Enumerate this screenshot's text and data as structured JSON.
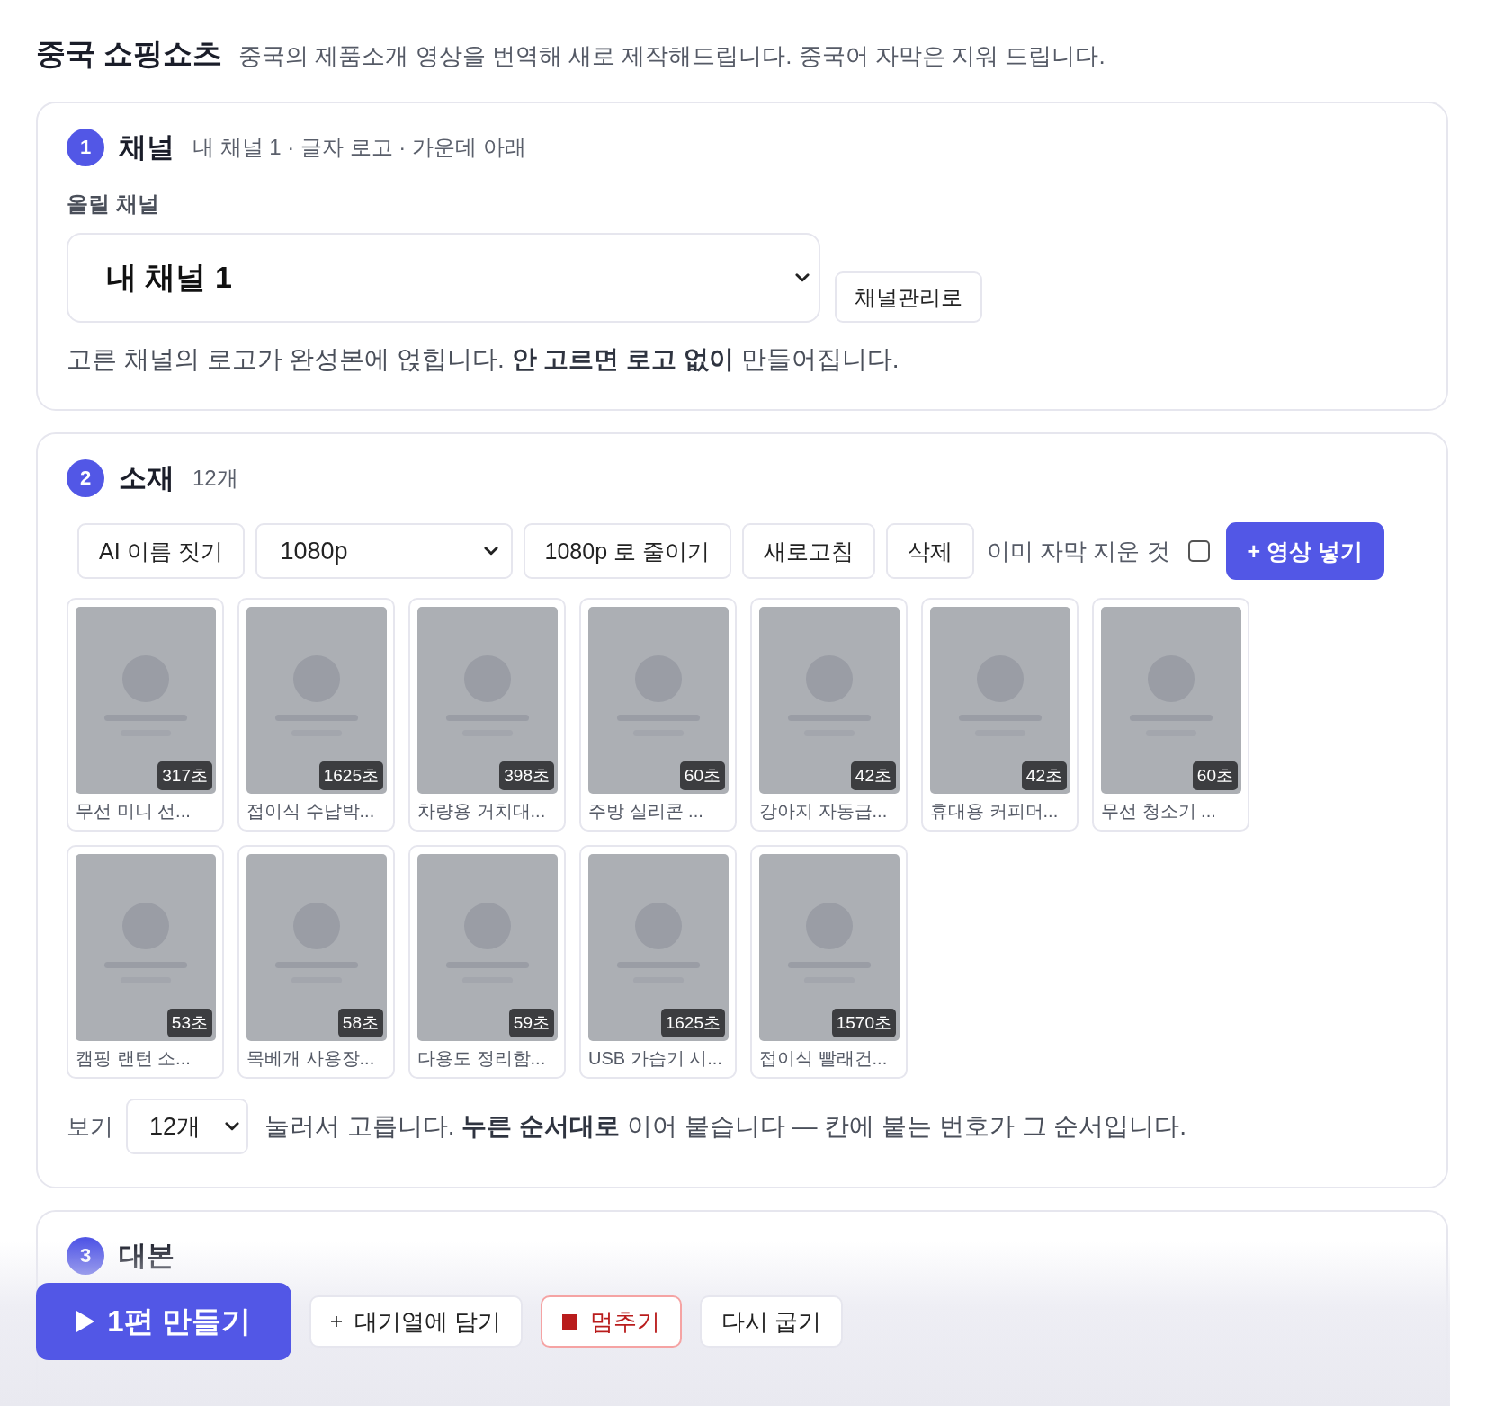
{
  "header": {
    "title": "중국 쇼핑쇼츠",
    "subtitle": "중국의 제품소개 영상을 번역해 새로 제작해드립니다. 중국어 자막은 지워 드립니다."
  },
  "channel_section": {
    "number": "1",
    "title": "채널",
    "summary": "내 채널 1 · 글자 로고 · 가운데 아래",
    "field_label": "올릴 채널",
    "channel_select": "내 채널 1",
    "manage_button": "채널관리로",
    "note": "고른 채널의 로고가 완성본에 얹힙니다. **안 고르면 로고 없이** 만들어집니다."
  },
  "material_section": {
    "number": "2",
    "title": "소재",
    "count": "12개",
    "toolbar": [
      {
        "kind": "button",
        "label": "AI 이름 짓기"
      },
      {
        "kind": "select",
        "label": "1080p"
      },
      {
        "kind": "button",
        "label": "1080p 로 줄이기"
      },
      {
        "kind": "button",
        "label": "새로고침"
      },
      {
        "kind": "button",
        "label": "삭제"
      },
      {
        "kind": "checkbox",
        "label": "이미 자막 지운 것",
        "checked": false
      },
      {
        "kind": "primary",
        "label": "+ 영상 넣기"
      }
    ],
    "clips": [
      {
        "duration": "317초",
        "name": "무선 미니 선..."
      },
      {
        "duration": "1625초",
        "name": "접이식 수납박..."
      },
      {
        "duration": "398초",
        "name": "차량용 거치대..."
      },
      {
        "duration": "60초",
        "name": "주방 실리콘 ..."
      },
      {
        "duration": "42초",
        "name": "강아지 자동급..."
      },
      {
        "duration": "42초",
        "name": "휴대용 커피머..."
      },
      {
        "duration": "60초",
        "name": "무선 청소기 ..."
      },
      {
        "duration": "53초",
        "name": "캠핑 랜턴 소..."
      },
      {
        "duration": "58초",
        "name": "목베개 사용장..."
      },
      {
        "duration": "59초",
        "name": "다용도 정리함..."
      },
      {
        "duration": "1625초",
        "name": "USB 가습기 시..."
      },
      {
        "duration": "1570초",
        "name": "접이식 빨래건..."
      }
    ],
    "view_label": "보기",
    "view_select": "12개",
    "hint": "눌러서 고릅니다. **누른 순서대로** 이어 붙습니다 — 칸에 붙는 번호가 그 순서입니다."
  },
  "script_section": {
    "number": "3",
    "title": "대본"
  },
  "action_bar": [
    {
      "kind": "primary",
      "label": "1편 만들기"
    },
    {
      "kind": "add",
      "label": "대기열에 담기"
    },
    {
      "kind": "stop",
      "label": "멈추기"
    },
    {
      "kind": "plain",
      "label": "다시 굽기"
    }
  ]
}
